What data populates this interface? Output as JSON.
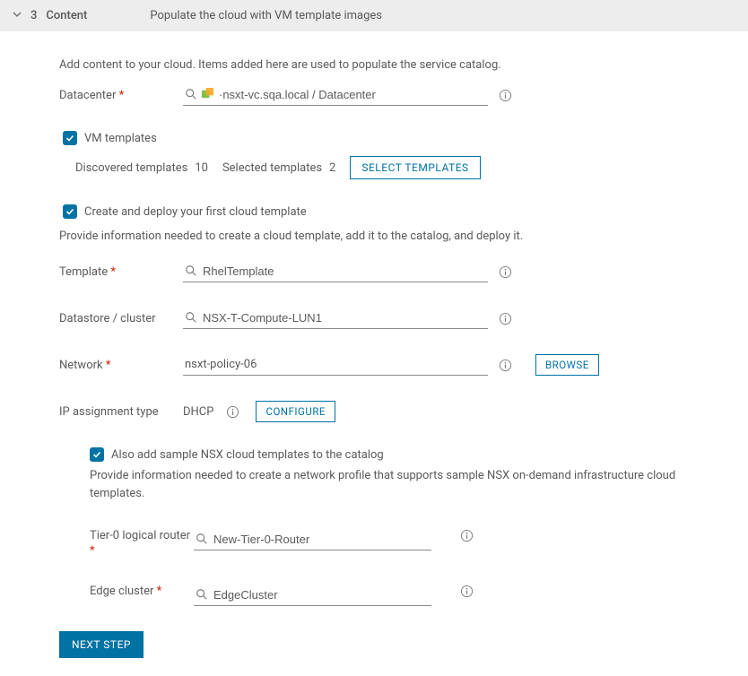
{
  "header": {
    "step_num": "3",
    "step_title": "Content",
    "step_subtitle": "Populate the cloud with VM template images"
  },
  "intro": "Add content to your cloud. Items added here are used to populate the service catalog.",
  "datacenter": {
    "label": "Datacenter",
    "value": "·nsxt-vc.sqa.local / Datacenter"
  },
  "vm_templates": {
    "label": "VM templates",
    "discovered_label": "Discovered templates",
    "discovered_value": "10",
    "selected_label": "Selected templates",
    "selected_value": "2",
    "select_btn": "SELECT TEMPLATES"
  },
  "create_deploy": {
    "label": "Create and deploy your first cloud template",
    "desc": "Provide information needed to create a cloud template, add it to the catalog, and deploy it."
  },
  "template": {
    "label": "Template",
    "value": "RhelTemplate"
  },
  "datastore": {
    "label": "Datastore / cluster",
    "value": "NSX-T-Compute-LUN1"
  },
  "network": {
    "label": "Network",
    "value": "nsxt-policy-06",
    "browse_btn": "BROWSE"
  },
  "ip_assignment": {
    "label": "IP assignment type",
    "value": "DHCP",
    "configure_btn": "CONFIGURE"
  },
  "nsx": {
    "checkbox_label": "Also add sample NSX cloud templates to the catalog",
    "desc": "Provide information needed to create a network profile that supports sample NSX on-demand infrastructure cloud templates.",
    "tier0_label": "Tier-0 logical router",
    "tier0_value": "New-Tier-0-Router",
    "edge_label": "Edge cluster",
    "edge_value": "EdgeCluster"
  },
  "footer": {
    "next_btn": "NEXT STEP"
  }
}
